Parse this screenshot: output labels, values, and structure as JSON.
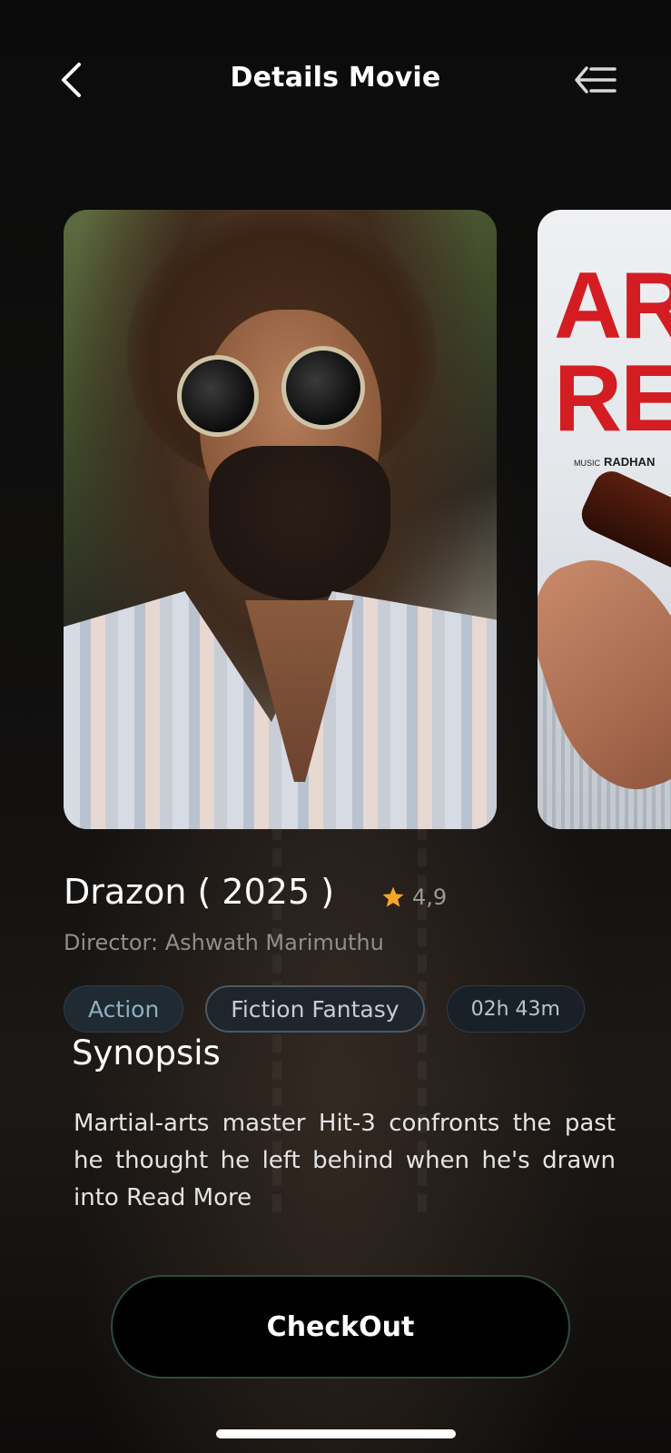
{
  "header": {
    "title": "Details Movie",
    "back_icon": "chevron-left-icon",
    "menu_icon": "menu-arrow-left-icon"
  },
  "posters": {
    "next_title_text": "AR RE",
    "next_credit_label": "MUSIC",
    "next_credit_name": "RADHAN"
  },
  "movie": {
    "title": "Drazon ( 2025 )",
    "rating": "4,9",
    "rating_icon": "star-icon",
    "director": "Director: Ashwath Marimuthu",
    "tags": [
      "Action",
      "Fiction Fantasy",
      "02h 43m"
    ]
  },
  "synopsis": {
    "heading": "Synopsis",
    "text": "Martial-arts master Hit-3 confronts the past he thought he left behind when he's drawn into ",
    "read_more": "Read More"
  },
  "checkout": {
    "label": "CheckOut"
  },
  "colors": {
    "background": "#0a0a0a",
    "star": "#f5a623",
    "tag_background": "#1f2a33",
    "checkout_border": "#2f4a3e"
  }
}
